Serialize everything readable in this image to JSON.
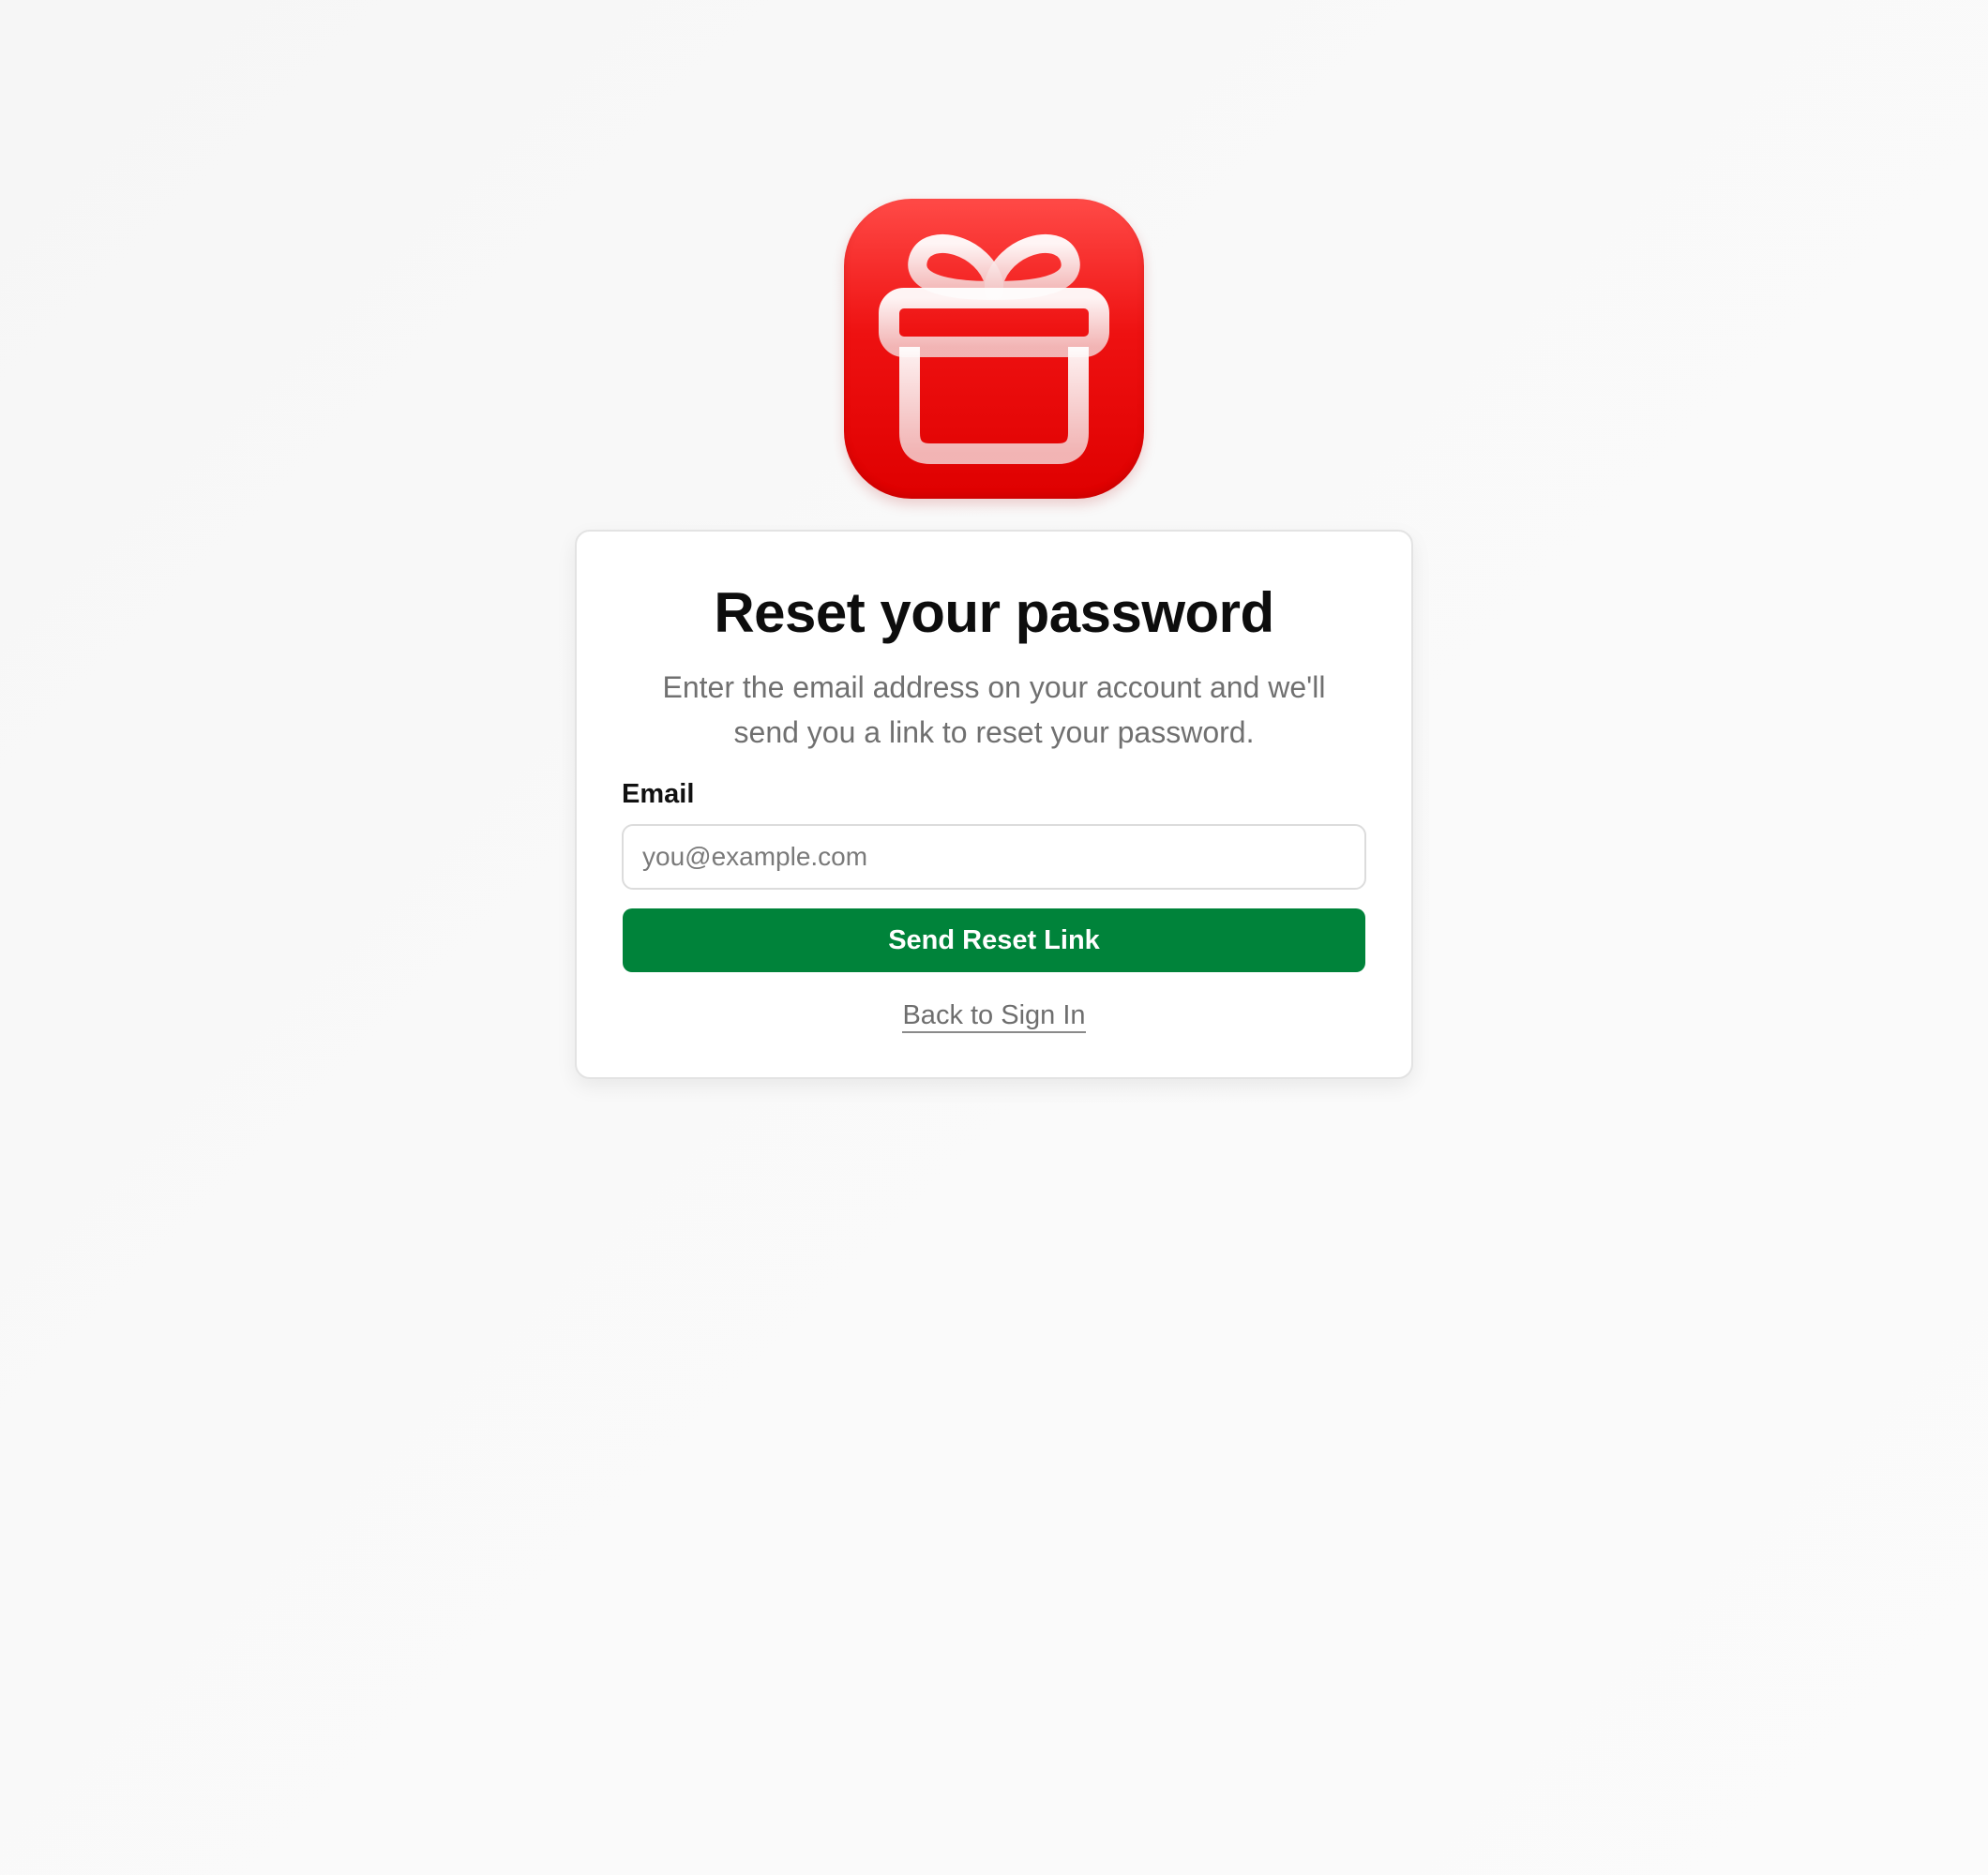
{
  "app": {
    "logo_icon": "gift-icon",
    "brand_color": "#e00000"
  },
  "card": {
    "title": "Reset your password",
    "subtitle": "Enter the email address on your account and we'll send you a link to reset your password.",
    "email_label": "Email",
    "email_placeholder": "you@example.com",
    "email_value": "",
    "submit_label": "Send Reset Link",
    "back_link_label": "Back to Sign In"
  },
  "colors": {
    "primary_button": "#00833a",
    "background": "#f8f8f8"
  }
}
